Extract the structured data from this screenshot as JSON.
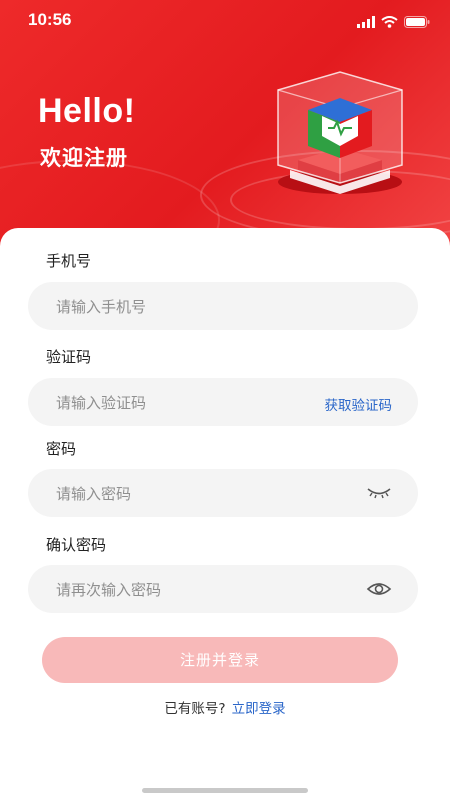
{
  "status_bar": {
    "time": "10:56"
  },
  "hero": {
    "greeting": "Hello!",
    "subtitle": "欢迎注册"
  },
  "form": {
    "phone": {
      "label": "手机号",
      "placeholder": "请输入手机号"
    },
    "code": {
      "label": "验证码",
      "placeholder": "请输入验证码",
      "action": "获取验证码"
    },
    "password": {
      "label": "密码",
      "placeholder": "请输入密码"
    },
    "confirm": {
      "label": "确认密码",
      "placeholder": "请再次输入密码"
    },
    "submit_label": "注册并登录"
  },
  "footer": {
    "prompt": "已有账号?",
    "login_link": "立即登录"
  },
  "colors": {
    "brand_red": "#e31b1f",
    "submit_disabled": "#f8b9b9",
    "link_blue": "#2a66c9",
    "field_bg": "#f4f4f4"
  },
  "icons": [
    "signal-icon",
    "wifi-icon",
    "battery-icon",
    "eye-closed-icon",
    "eye-open-icon",
    "cube-logo-icon"
  ]
}
